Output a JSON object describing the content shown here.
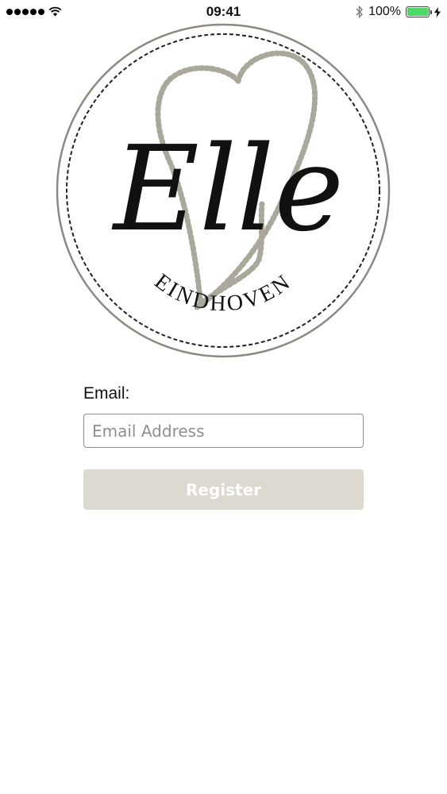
{
  "status_bar": {
    "time": "09:41",
    "battery_percent": "100%",
    "battery_level": 1.0,
    "icons": [
      "signal-dots-icon",
      "wifi-icon",
      "bluetooth-icon",
      "battery-icon",
      "charging-icon"
    ]
  },
  "logo": {
    "script_text": "Elle",
    "city_text": "EINDHOVEN",
    "colors": {
      "ring": "#8c8a80",
      "dashed_ring": "#222222",
      "hearts": "#aaa79b",
      "text": "#111111"
    }
  },
  "form": {
    "email_label": "Email:",
    "email_placeholder": "Email Address",
    "email_value": "",
    "register_label": "Register"
  },
  "colors": {
    "button_background": "#ddd9d1",
    "button_text": "#ffffff",
    "input_border": "#8e8e8e"
  }
}
